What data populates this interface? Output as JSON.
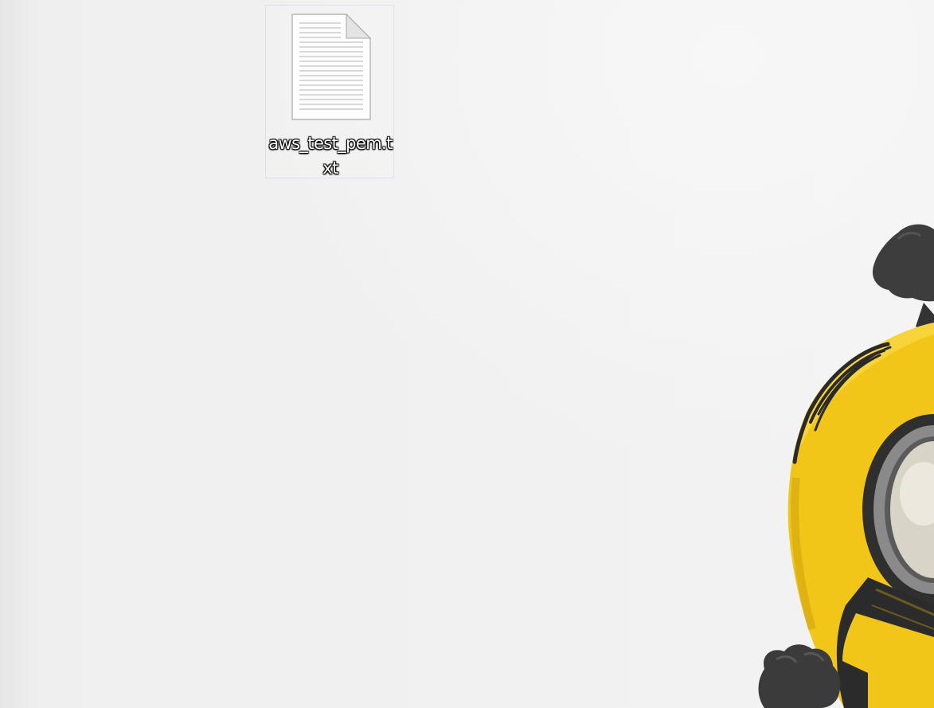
{
  "desktop": {
    "wallpaper": "minion-character",
    "icons": [
      {
        "label": "aws_test_pem.txt",
        "icon": "text-document-icon"
      }
    ]
  },
  "colors": {
    "background": "#f0f0f0",
    "minion_yellow": "#f2c619",
    "goggle_frame": "#3a3a3a",
    "label_text": "#ffffff"
  }
}
